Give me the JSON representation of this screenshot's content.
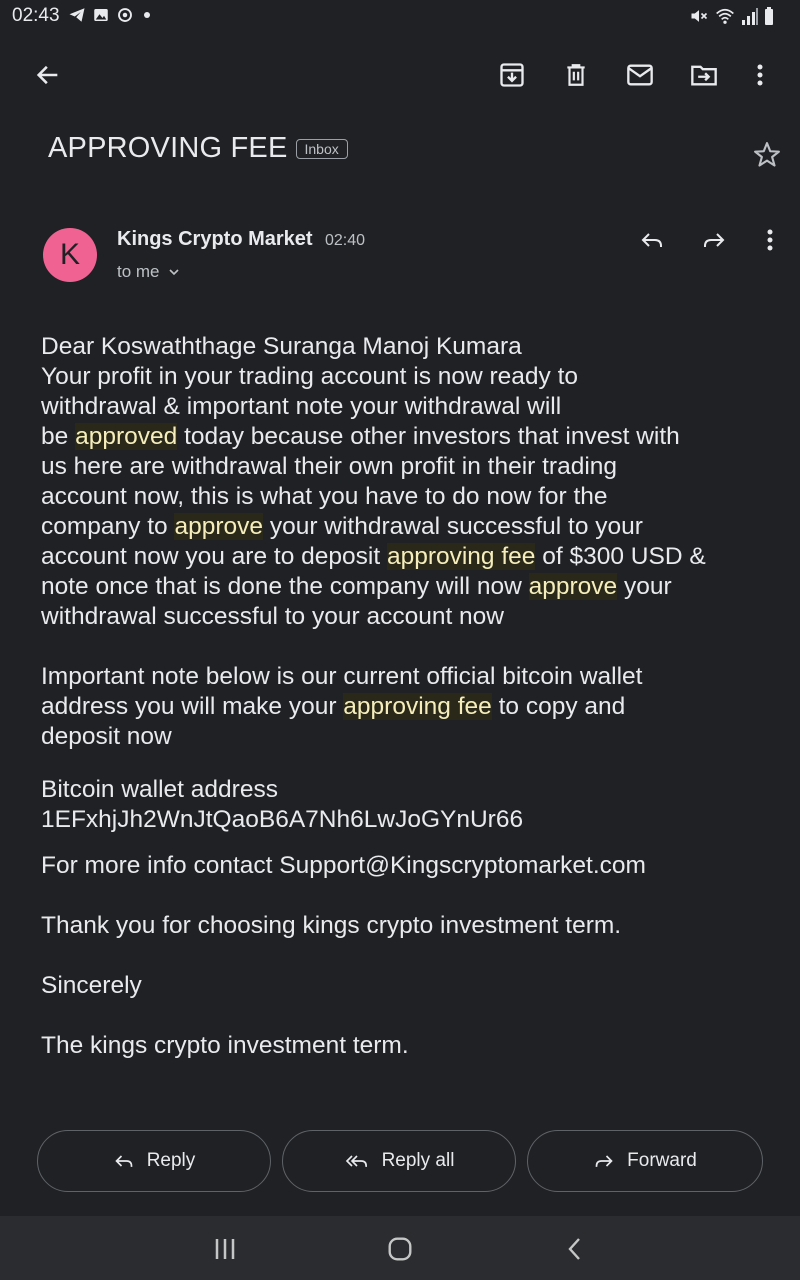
{
  "status_bar": {
    "time": "02:43",
    "left_icons": [
      "telegram-icon",
      "gallery-icon",
      "sync-icon",
      "dot-icon"
    ],
    "right_icons": [
      "mute-icon",
      "wifi-icon",
      "signal-icon",
      "battery-icon"
    ]
  },
  "toolbar": {
    "back_icon": "arrow-back-icon",
    "actions": [
      "archive-icon",
      "delete-icon",
      "mark-unread-icon",
      "move-to-icon",
      "more-vert-icon"
    ]
  },
  "message": {
    "subject": "APPROVING FEE",
    "label": "Inbox",
    "avatar_letter": "K",
    "avatar_color": "#f06292",
    "sender": "Kings Crypto Market",
    "time": "02:40",
    "recipients": "to me"
  },
  "body": {
    "greeting": "Dear Koswaththage Suranga Manoj Kumara",
    "p1": {
      "s1": "Your profit in your trading account is now ready to",
      "s2": "withdrawal & important note your withdrawal will",
      "s3": "be",
      "h1": "approved",
      "s4": "today because other investors that invest with",
      "s5": "us here are withdrawal their own profit in their trading",
      "s6": "account now, this is what you have to do now for the",
      "s7": "company to",
      "h2": "approve",
      "s8": "your withdrawal successful to your",
      "s9": "account now you are to deposit",
      "h3": "approving fee",
      "s10": "of $300 USD &",
      "s11": "note once that is done the company will now",
      "h4": "approve",
      "s12": "your",
      "s13": "withdrawal successful to your account now"
    },
    "p2": {
      "s1": "Important note below is our current official bitcoin wallet",
      "s2": "address you will make your",
      "h1": "approving fee",
      "s3": "to copy and",
      "s4": "deposit now"
    },
    "wallet_label": "Bitcoin wallet address",
    "wallet_address": "1EFxhjJh2WnJtQaoB6A7Nh6LwJoGYnUr66",
    "contact": "For more info contact Support@Kingscryptomarket.com",
    "thanks": "Thank you for choosing kings crypto investment term.",
    "closing": "Sincerely",
    "signature": "The kings crypto investment term.",
    "highlight_color": "#f5eebc"
  },
  "actions": {
    "reply": "Reply",
    "reply_all": "Reply all",
    "forward": "Forward"
  },
  "nav": {
    "items": [
      "recents-icon",
      "home-icon",
      "back-icon"
    ]
  }
}
